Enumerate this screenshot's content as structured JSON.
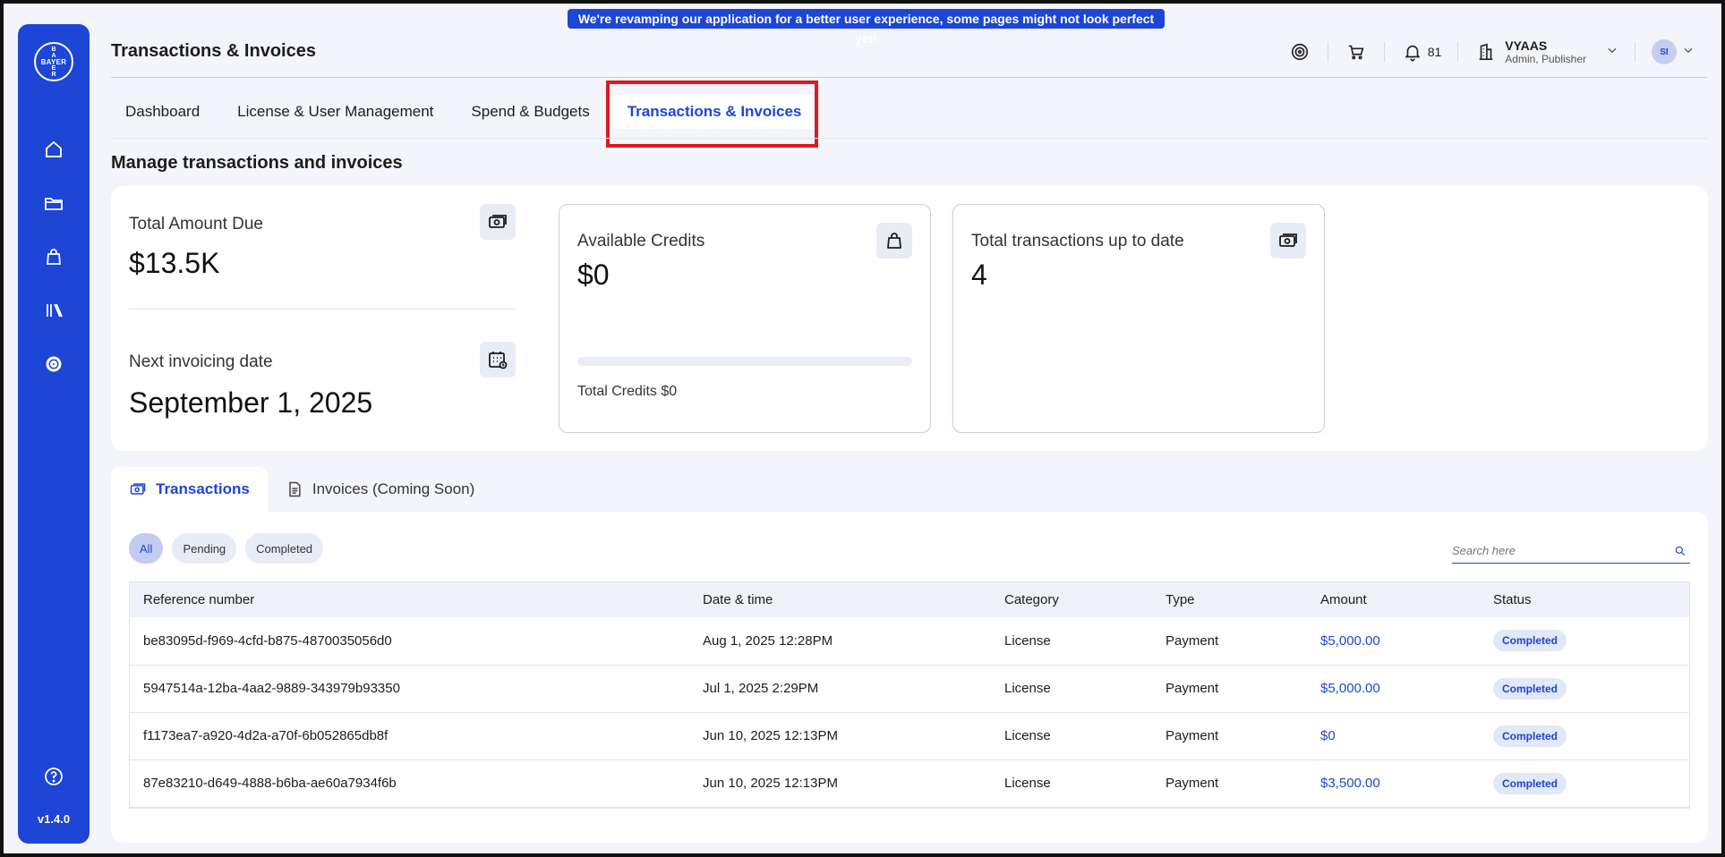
{
  "banner": {
    "text": "We're revamping our application for a better user experience, some pages might not look perfect yet!"
  },
  "sidebar": {
    "logo_vertical": [
      "B",
      "A",
      "Y",
      "E",
      "R"
    ],
    "logo_horizontal": "BAYER",
    "items": [
      {
        "icon": "home-icon"
      },
      {
        "icon": "folder-icon"
      },
      {
        "icon": "bag-icon"
      },
      {
        "icon": "library-icon"
      },
      {
        "icon": "gear-icon"
      }
    ],
    "help_icon": "help-icon",
    "version": "v1.4.0"
  },
  "header": {
    "title": "Transactions & Invoices",
    "notifications_count": "81",
    "user_name": "VYAAS",
    "user_role": "Admin, Publisher",
    "avatar_initials": "SI"
  },
  "tabs": [
    {
      "label": "Dashboard",
      "active": false
    },
    {
      "label": "License & User Management",
      "active": false
    },
    {
      "label": "Spend & Budgets",
      "active": false
    },
    {
      "label": "Transactions & Invoices",
      "active": true
    }
  ],
  "section_title": "Manage transactions and invoices",
  "summary": {
    "total_due_label": "Total Amount Due",
    "total_due_value": "$13.5K",
    "next_invoice_label": "Next invoicing date",
    "next_invoice_value": "September 1, 2025",
    "available_credits_label": "Available Credits",
    "available_credits_value": "$0",
    "credits_fraction": 0,
    "total_credits_text": "Total Credits $0",
    "total_txn_label": "Total transactions up to date",
    "total_txn_value": "4"
  },
  "txn_tabs": [
    {
      "label": "Transactions",
      "active": true
    },
    {
      "label": "Invoices (Coming Soon)",
      "active": false
    }
  ],
  "filters": [
    {
      "label": "All",
      "active": true
    },
    {
      "label": "Pending",
      "active": false
    },
    {
      "label": "Completed",
      "active": false
    }
  ],
  "search": {
    "placeholder": "Search here"
  },
  "table": {
    "columns": [
      "Reference number",
      "Date & time",
      "Category",
      "Type",
      "Amount",
      "Status"
    ],
    "rows": [
      [
        "be83095d-f969-4cfd-b875-4870035056d0",
        "Aug 1, 2025 12:28PM",
        "License",
        "Payment",
        "$5,000.00",
        "Completed"
      ],
      [
        "5947514a-12ba-4aa2-9889-343979b93350",
        "Jul 1, 2025 2:29PM",
        "License",
        "Payment",
        "$5,000.00",
        "Completed"
      ],
      [
        "f1173ea7-a920-4d2a-a70f-6b052865db8f",
        "Jun 10, 2025 12:13PM",
        "License",
        "Payment",
        "$0",
        "Completed"
      ],
      [
        "87e83210-d649-4888-b6ba-ae60a7934f6b",
        "Jun 10, 2025 12:13PM",
        "License",
        "Payment",
        "$3,500.00",
        "Completed"
      ]
    ]
  },
  "colors": {
    "brand": "#1d45d6",
    "highlight": "#e0181f",
    "background": "#f3f5fa"
  }
}
